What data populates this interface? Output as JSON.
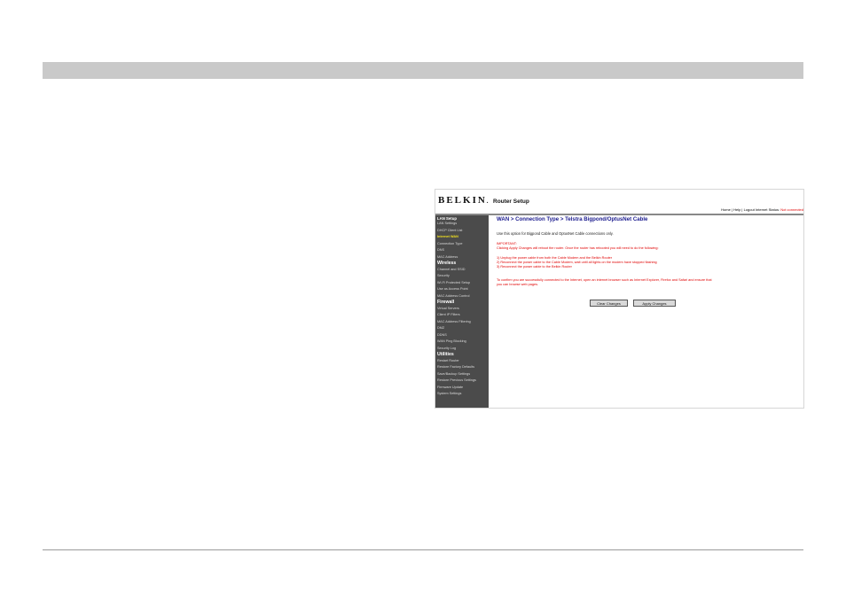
{
  "header": {
    "logo": "BELKIN",
    "logo_dot": ".",
    "app_title": "Router Setup",
    "links": "Home | Help | Logout",
    "status_label": "Internet Status:",
    "status_value": "Not connected"
  },
  "sidebar": {
    "sections": [
      {
        "title": "LAN Setup",
        "items": [
          "LAN Settings",
          "DHCP Client List"
        ]
      },
      {
        "title": "Internet WAN",
        "active": true,
        "items": [
          "Connection Type",
          "DNS",
          "MAC Address"
        ]
      },
      {
        "title": "Wireless",
        "items": [
          "Channel and SSID",
          "Security",
          "Wi-Fi Protected Setup",
          "Use as Access Point",
          "MAC Address Control"
        ]
      },
      {
        "title": "Firewall",
        "items": [
          "Virtual Servers",
          "Client IP Filters",
          "MAC Address Filtering",
          "DMZ",
          "DDNS",
          "WAN Ping Blocking",
          "Security Log"
        ]
      },
      {
        "title": "Utilities",
        "items": [
          "Restart Router",
          "Restore Factory Defaults",
          "Save/Backup Settings",
          "Restore Previous Settings",
          "Firmware Update",
          "System Settings"
        ]
      }
    ]
  },
  "main": {
    "breadcrumb": "WAN > Connection Type > Telstra Bigpond/OptusNet Cable",
    "intro": "Use this option for Bigpond Cable and OptusNet Cable connections only.",
    "important_heading": "IMPORTANT:",
    "important_text": "Clicking Apply Changes will reboot the router. Once the router has rebooted you will need to do the following:",
    "steps": [
      "1) Unplug the power cable from both the Cable Modem and the Belkin Router",
      "2) Reconnect the power cable to the Cable Modem, wait until all lights on the modem have stopped flashing",
      "3) Reconnect the power cable to the Belkin Router"
    ],
    "confirm_line1": "To confirm you are successfully connected to the Internet, open an internet browser such as Internet Explorer, Firefox and Safari and ensure that",
    "confirm_line2": "you can browse web pages.",
    "clear_button": "Clear Changes",
    "apply_button": "Apply Changes"
  },
  "colors": {
    "top_bar": "#c9c9c9",
    "sidebar_bg": "#4b4b4b",
    "breadcrumb": "#1a1a8e",
    "warning_red": "#e00000",
    "active_nav": "#f0e020"
  }
}
